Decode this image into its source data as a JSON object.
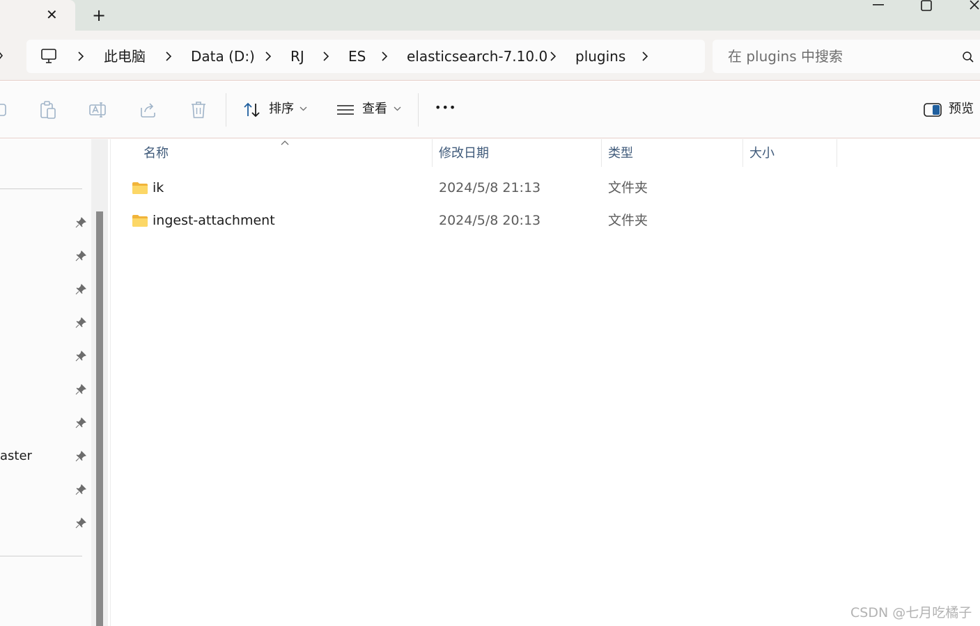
{
  "window": {
    "tab_close_icon": "close-icon",
    "new_tab_icon": "plus-icon",
    "controls": [
      "minimize-icon",
      "maximize-icon",
      "close-icon"
    ]
  },
  "address": {
    "crumbs": [
      "此电脑",
      "Data (D:)",
      "RJ",
      "ES",
      "elasticsearch-7.10.0",
      "plugins"
    ]
  },
  "search": {
    "placeholder": "在 plugins 中搜索"
  },
  "toolbar": {
    "sort_label": "排序",
    "view_label": "查看",
    "more_label": "•••",
    "preview_label": "预览"
  },
  "nav": {
    "partial_item": "aster"
  },
  "columns": {
    "name": "名称",
    "modified": "修改日期",
    "type": "类型",
    "size": "大小"
  },
  "files": [
    {
      "name": "ik",
      "modified": "2024/5/8 21:13",
      "type": "文件夹",
      "size": ""
    },
    {
      "name": "ingest-attachment",
      "modified": "2024/5/8 20:13",
      "type": "文件夹",
      "size": ""
    }
  ],
  "watermark": "CSDN @七月吃橘子",
  "colors": {
    "titlebar": "#dfe5e0",
    "chrome": "#f4f2f0",
    "header_text": "#3f5a7a",
    "folder": "#f8c94e",
    "accent": "#1f5f9e"
  }
}
